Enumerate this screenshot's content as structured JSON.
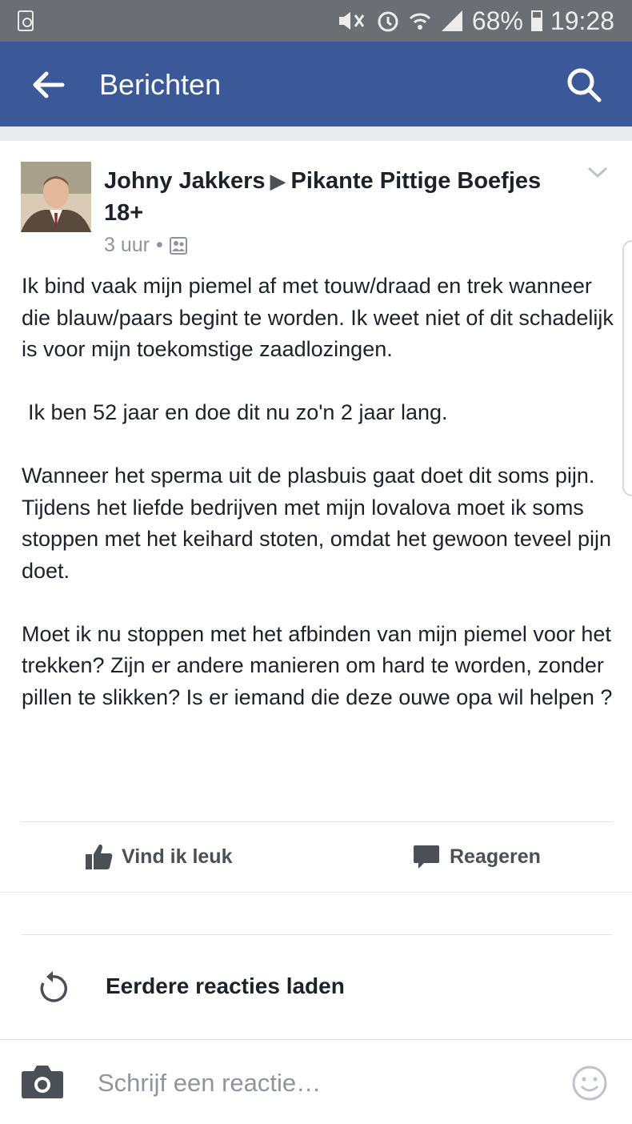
{
  "status_bar": {
    "battery": "68%",
    "time": "19:28"
  },
  "nav": {
    "title": "Berichten"
  },
  "post": {
    "author": "Johny Jakkers",
    "group": "Pikante Pittige Boefjes 18+",
    "time": "3 uur",
    "separator": "•",
    "body": {
      "p1": "Ik bind vaak mijn piemel af met touw/draad en trek wanneer die blauw/paars begint te worden. Ik weet niet of dit schadelijk is voor mijn toekomstige zaadlozingen.",
      "p2": "Ik ben 52 jaar en doe dit nu zo'n 2 jaar lang.",
      "p3": "Wanneer het sperma uit de plasbuis gaat doet dit soms pijn.",
      "p4": "Tijdens het liefde bedrijven met mijn lovalova moet ik soms stoppen met het keihard stoten, omdat het gewoon teveel pijn doet.",
      "p5": "Moet ik nu stoppen met het afbinden van mijn piemel voor het trekken? Zijn er andere manieren om hard te worden, zonder pillen te slikken? Is er iemand die deze ouwe opa wil helpen ?"
    },
    "actions": {
      "like": "Vind ik leuk",
      "comment": "Reageren"
    }
  },
  "comments": {
    "load_more": "Eerdere reacties laden"
  },
  "composer": {
    "placeholder": "Schrijf een reactie…"
  },
  "colors": {
    "brand": "#3b5998",
    "status_bar": "#6b6e72"
  }
}
